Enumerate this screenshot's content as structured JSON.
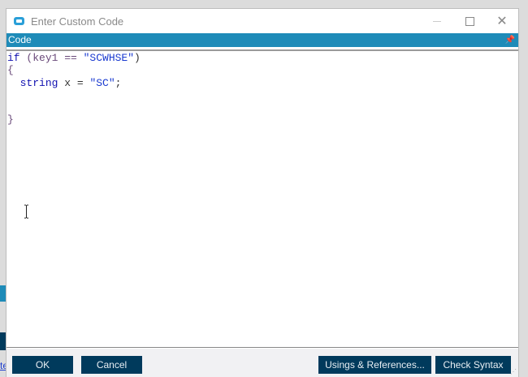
{
  "window": {
    "title": "Enter Custom Code"
  },
  "panel": {
    "title": "Code"
  },
  "code": {
    "line1": {
      "kw": "if",
      "rest": " (key1 == ",
      "str": "\"SCWHSE\"",
      "end": ")"
    },
    "line2": "{",
    "line3": {
      "indent": "  ",
      "kw": "string",
      "rest": " x = ",
      "str": "\"SC\"",
      "end": ";"
    },
    "line6": "}"
  },
  "background": {
    "link_fragment": "te"
  },
  "buttons": {
    "ok": "OK",
    "cancel": "Cancel",
    "usings": "Usings & References...",
    "check": "Check Syntax"
  }
}
